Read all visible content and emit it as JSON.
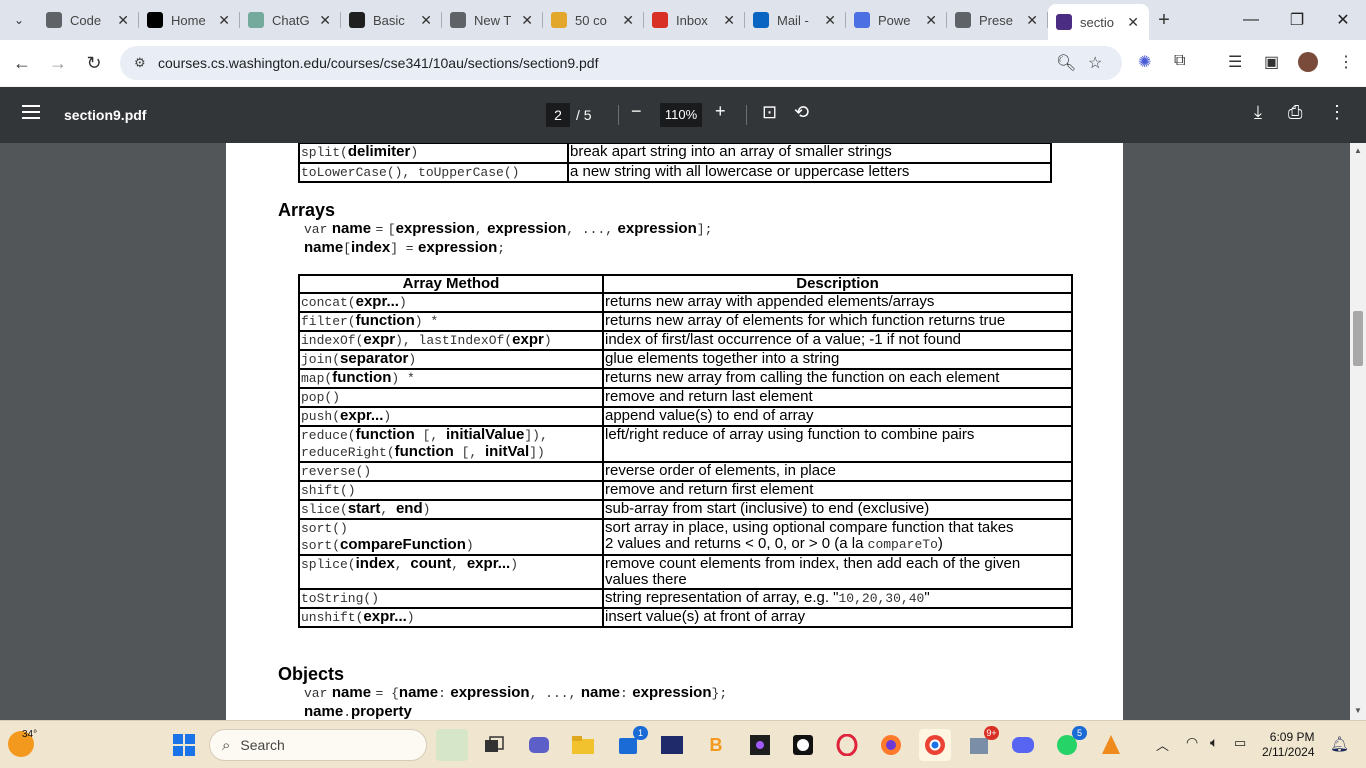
{
  "tabs": [
    {
      "title": "Code",
      "icon": "globe-icon",
      "color": "#5f6368"
    },
    {
      "title": "Home",
      "icon": "x-logo-icon",
      "color": "#000000"
    },
    {
      "title": "ChatG",
      "icon": "chatgpt-icon",
      "color": "#74aa9c"
    },
    {
      "title": "Basic",
      "icon": "anthropic-icon",
      "color": "#1f1f1f"
    },
    {
      "title": "New T",
      "icon": "globe-icon",
      "color": "#5f6368"
    },
    {
      "title": "50 co",
      "icon": "image-icon",
      "color": "#e3a82b"
    },
    {
      "title": "Inbox",
      "icon": "gmail-icon",
      "color": "#d93025"
    },
    {
      "title": "Mail -",
      "icon": "outlook-icon",
      "color": "#0a64c1"
    },
    {
      "title": "Powe",
      "icon": "copilot-icon",
      "color": "#4c6fe4"
    },
    {
      "title": "Prese",
      "icon": "globe-icon",
      "color": "#5f6368"
    },
    {
      "title": "sectio",
      "icon": "uw-icon",
      "color": "#4b2e83",
      "active": true
    }
  ],
  "address": {
    "url": "courses.cs.washington.edu/courses/cse341/10au/sections/section9.pdf"
  },
  "pdf": {
    "filename": "section9.pdf",
    "page_current": "2",
    "page_total": "/ 5",
    "zoom": "110%"
  },
  "doc": {
    "top_rows": [
      {
        "fn": "split",
        "args": "delimiter",
        "desc": "break apart string into an array of smaller strings"
      },
      {
        "fn": "toLowerCase(), toUpperCase()",
        "args": "",
        "desc": "a new string with all lowercase or uppercase letters"
      }
    ],
    "arrays_heading": "Arrays",
    "arrays_code": {
      "l1_var": "var",
      "l1_name": "name",
      "l1_eq": "=",
      "l1_open": "[",
      "l1_expr1": "expression",
      "l1_comma1": ",",
      "l1_expr2": "expression",
      "l1_dots": ", ...,",
      "l1_expr3": "expression",
      "l1_close": "];",
      "l2_name": "name",
      "l2_open": "[",
      "l2_index": "index",
      "l2_close": "] =",
      "l2_expr": "expression",
      "l2_semi": ";"
    },
    "table_headers": [
      "Array Method",
      "Description"
    ],
    "rows": [
      {
        "c1": [
          "concat(",
          "expr...",
          ")"
        ],
        "desc": "returns new array with appended elements/arrays"
      },
      {
        "c1": [
          "filter(",
          "function",
          ")     *"
        ],
        "desc": "returns new array of elements for which function returns true"
      },
      {
        "c1": [
          "indexOf(",
          "expr",
          "), lastIndexOf(",
          "expr",
          ")"
        ],
        "desc": "index of first/last occurrence of a value; -1 if not found"
      },
      {
        "c1": [
          "join(",
          "separator",
          ")"
        ],
        "desc": "glue elements together into a string"
      },
      {
        "c1": [
          "map(",
          "function",
          ")        *"
        ],
        "desc": "returns new array from calling the function on each element"
      },
      {
        "c1": [
          "pop()"
        ],
        "desc": "remove and return last element"
      },
      {
        "c1": [
          "push(",
          "expr...",
          ")"
        ],
        "desc": "append value(s) to end of array"
      },
      {
        "c1": [
          "reduce(",
          "function",
          " [, ",
          "initialValue",
          "]),"
        ],
        "c1b": [
          "reduceRight(",
          "function",
          " [, ",
          "initVal",
          "])"
        ],
        "desc": "left/right reduce of array using function to combine pairs"
      },
      {
        "c1": [
          "reverse()"
        ],
        "desc": "reverse order of elements, in place"
      },
      {
        "c1": [
          "shift()"
        ],
        "desc": "remove and return first element"
      },
      {
        "c1": [
          "slice(",
          "start",
          ", ",
          "end",
          ")"
        ],
        "desc": "sub-array from start (inclusive) to end (exclusive)"
      },
      {
        "c1": [
          "sort()"
        ],
        "c1b": [
          "sort(",
          "compareFunction",
          ")"
        ],
        "desc": "sort array in place, using optional compare function that takes",
        "desc2_pre": "2 values and returns < 0, 0, or > 0 (a la ",
        "desc2_code": "compareTo",
        "desc2_post": ")"
      },
      {
        "c1": [
          "splice(",
          "index",
          ", ",
          "count",
          ", ",
          "expr...",
          ")"
        ],
        "desc": "remove count elements from index, then add each of the given",
        "desc2_pre": "values there"
      },
      {
        "c1": [
          "toString()"
        ],
        "desc": "string representation of array, e.g. \"",
        "desc_code": "10,20,30,40",
        "desc_post": "\""
      },
      {
        "c1": [
          "unshift(",
          "expr...",
          ")"
        ],
        "desc": "insert value(s) at front of array"
      }
    ],
    "objects_heading": "Objects",
    "objects_code": {
      "l1_var": "var",
      "l1_name": "name",
      "l1_eq": "= {",
      "l1_n1": "name",
      "l1_colon1": ":",
      "l1_e1": "expression",
      "l1_dots": ", ...,",
      "l1_n2": "name",
      "l1_colon2": ":",
      "l1_e2": "expression",
      "l1_close": "};",
      "l2_name": "name",
      "l2_dot": ".",
      "l2_prop": "property"
    }
  },
  "taskbar": {
    "weather": "34°",
    "search_placeholder": "Search",
    "time": "6:09 PM",
    "date": "2/11/2024",
    "badges": {
      "store": "1",
      "apps": "9+",
      "whatsapp": "5"
    }
  }
}
